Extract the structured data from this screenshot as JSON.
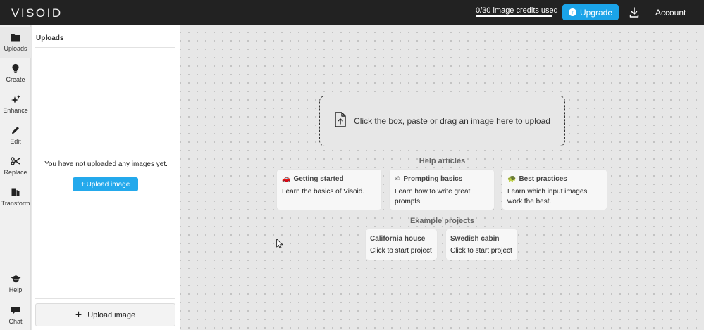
{
  "header": {
    "logo": "VISOID",
    "credits_text": "0/30 image credits used",
    "upgrade_label": "Upgrade",
    "account_label": "Account"
  },
  "rail": {
    "items": [
      {
        "label": "Uploads",
        "icon": "folder-icon"
      },
      {
        "label": "Create",
        "icon": "lightbulb-icon"
      },
      {
        "label": "Enhance",
        "icon": "sparkles-icon"
      },
      {
        "label": "Edit",
        "icon": "pencil-icon"
      },
      {
        "label": "Replace",
        "icon": "scissors-icon"
      },
      {
        "label": "Transform",
        "icon": "transform-icon"
      },
      {
        "label": "Help",
        "icon": "graduation-cap-icon"
      },
      {
        "label": "Chat",
        "icon": "chat-bubble-icon"
      }
    ]
  },
  "uploads_panel": {
    "title": "Uploads",
    "empty_message": "You have not uploaded any images yet.",
    "upload_small_label": "Upload image",
    "upload_bottom_label": "Upload image"
  },
  "canvas": {
    "dropzone_text": "Click the box, paste or drag an image here to upload",
    "help_title": "Help articles",
    "help_articles": [
      {
        "title": "Getting started",
        "desc": "Learn the basics of Visoid.",
        "emoji": "🚗"
      },
      {
        "title": "Prompting basics",
        "desc": "Learn how to write great prompts.",
        "emoji": "✍"
      },
      {
        "title": "Best practices",
        "desc": "Learn which input images work the best.",
        "emoji": "🐢"
      }
    ],
    "examples_title": "Example projects",
    "examples": [
      {
        "title": "California house",
        "desc": "Click to start project"
      },
      {
        "title": "Swedish cabin",
        "desc": "Click to start project"
      }
    ]
  },
  "colors": {
    "topbar": "#222222",
    "accent": "#1aa3e8",
    "canvas": "#e7e7e7"
  }
}
